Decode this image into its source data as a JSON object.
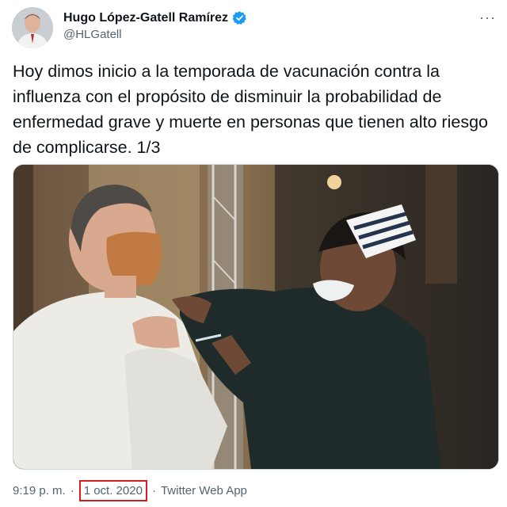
{
  "tweet": {
    "author_name": "Hugo López-Gatell Ramírez",
    "author_handle": "@HLGatell",
    "text": "Hoy dimos inicio a la temporada de vacunación contra la influenza con el propósito de disminuir la probabilidad de enfermedad grave y muerte en personas que tienen alto riesgo de complicarse. 1/3",
    "time": "9:19 p. m.",
    "separator": "·",
    "date": "1 oct. 2020",
    "source": "Twitter Web App",
    "more_label": "···"
  },
  "icons": {
    "verified": "verified-badge-icon",
    "more": "more-options-icon"
  },
  "colors": {
    "verified_blue": "#1d9bf0",
    "secondary_text": "#536471",
    "highlight_box": "#d11f1f"
  }
}
